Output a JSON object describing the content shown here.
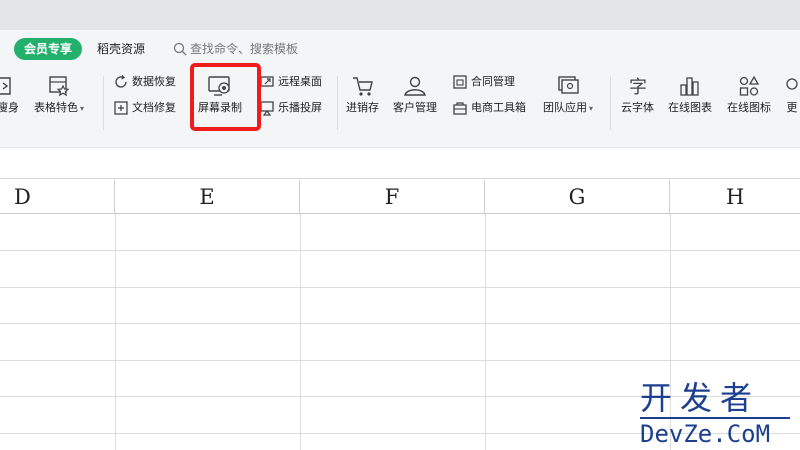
{
  "menubar": {
    "member_label": "会员专享",
    "resources_label": "稻壳资源",
    "search_placeholder": "查找命令、搜索模板"
  },
  "ribbon": {
    "slim_label": "瘦身",
    "table_feature_label": "表格特色",
    "data_recovery_label": "数据恢复",
    "doc_repair_label": "文档修复",
    "screen_record_label": "屏幕录制",
    "remote_desktop_label": "远程桌面",
    "cast_screen_label": "乐播投屏",
    "inventory_label": "进销存",
    "customer_label": "客户管理",
    "contract_label": "合同管理",
    "ecommerce_label": "电商工具箱",
    "team_app_label": "团队应用",
    "cloud_font_label": "云字体",
    "online_chart_label": "在线图表",
    "online_icon_label": "在线图标",
    "more_label": "更"
  },
  "sheet": {
    "columns": [
      "D",
      "E",
      "F",
      "G",
      "H"
    ]
  },
  "watermark": {
    "cn": "开发者",
    "en": "DevZe.CoM"
  },
  "colors": {
    "member_green": "#23b06c",
    "highlight_red": "#ee1c1c",
    "watermark_blue": "#1c3f8f"
  }
}
